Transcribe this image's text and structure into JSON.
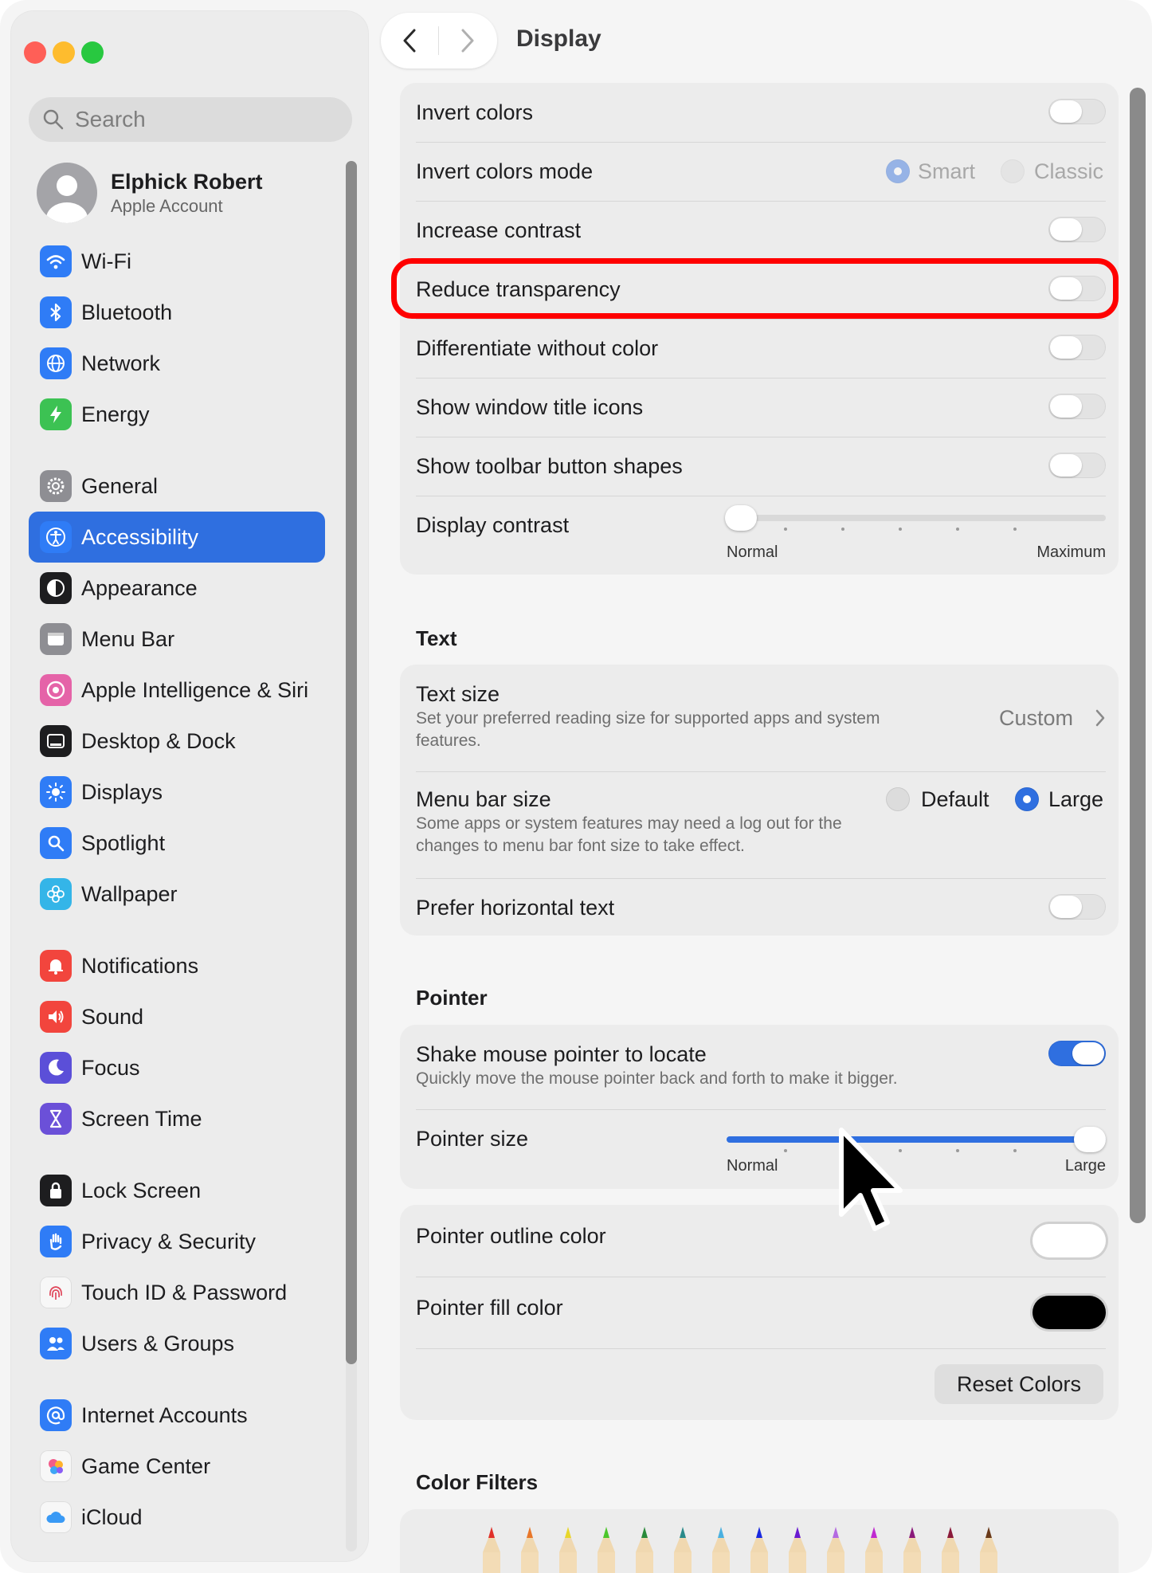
{
  "window": {
    "traffic_lights": [
      "#ff5f57",
      "#febc2e",
      "#28c840"
    ]
  },
  "sidebar": {
    "search_placeholder": "Search",
    "account": {
      "name": "Elphick Robert",
      "subtitle": "Apple Account"
    },
    "items": [
      {
        "label": "Wi-Fi",
        "icon": "wifi-icon",
        "color": "#2f7cf6"
      },
      {
        "label": "Bluetooth",
        "icon": "bluetooth-icon",
        "color": "#2f7cf6"
      },
      {
        "label": "Network",
        "icon": "globe-icon",
        "color": "#2f7cf6"
      },
      {
        "label": "Energy",
        "icon": "bolt-icon",
        "color": "#3cc253"
      },
      {
        "label": "General",
        "icon": "gear-icon",
        "color": "#8e8e93"
      },
      {
        "label": "Accessibility",
        "icon": "accessibility-icon",
        "color": "#2f7cf6",
        "selected": true
      },
      {
        "label": "Appearance",
        "icon": "appearance-icon",
        "color": "#1d1d1f"
      },
      {
        "label": "Menu Bar",
        "icon": "menubar-icon",
        "color": "#8e8e93"
      },
      {
        "label": "Apple Intelligence & Siri",
        "icon": "siri-icon",
        "color": "#e563a8"
      },
      {
        "label": "Desktop & Dock",
        "icon": "dock-icon",
        "color": "#1d1d1f"
      },
      {
        "label": "Displays",
        "icon": "sun-icon",
        "color": "#2f7cf6"
      },
      {
        "label": "Spotlight",
        "icon": "magnifier-icon",
        "color": "#2f7cf6"
      },
      {
        "label": "Wallpaper",
        "icon": "flower-icon",
        "color": "#34b5e8"
      },
      {
        "label": "Notifications",
        "icon": "bell-icon",
        "color": "#f2453d"
      },
      {
        "label": "Sound",
        "icon": "speaker-icon",
        "color": "#f2453d"
      },
      {
        "label": "Focus",
        "icon": "moon-icon",
        "color": "#5b4fd8"
      },
      {
        "label": "Screen Time",
        "icon": "hourglass-icon",
        "color": "#6b50d8"
      },
      {
        "label": "Lock Screen",
        "icon": "lock-icon",
        "color": "#1d1d1f"
      },
      {
        "label": "Privacy & Security",
        "icon": "hand-icon",
        "color": "#2f7cf6"
      },
      {
        "label": "Touch ID & Password",
        "icon": "fingerprint-icon",
        "color": "#f7f7f7"
      },
      {
        "label": "Users & Groups",
        "icon": "users-icon",
        "color": "#2f7cf6"
      },
      {
        "label": "Internet Accounts",
        "icon": "at-icon",
        "color": "#2f7cf6"
      },
      {
        "label": "Game Center",
        "icon": "gamecenter-icon",
        "color": "#f7f7f7"
      },
      {
        "label": "iCloud",
        "icon": "cloud-icon",
        "color": "#f7f7f7"
      }
    ]
  },
  "header": {
    "title": "Display"
  },
  "display": {
    "invert_colors": {
      "label": "Invert colors",
      "on": false
    },
    "invert_mode": {
      "label": "Invert colors mode",
      "options": [
        "Smart",
        "Classic"
      ],
      "selected": "Smart"
    },
    "increase_contrast": {
      "label": "Increase contrast",
      "on": false
    },
    "reduce_transparency": {
      "label": "Reduce transparency",
      "on": false
    },
    "differentiate": {
      "label": "Differentiate without color",
      "on": false
    },
    "title_icons": {
      "label": "Show window title icons",
      "on": false
    },
    "toolbar_shapes": {
      "label": "Show toolbar button shapes",
      "on": false
    },
    "display_contrast": {
      "label": "Display contrast",
      "min_label": "Normal",
      "max_label": "Maximum",
      "level": 0
    }
  },
  "text_section": {
    "heading": "Text",
    "text_size": {
      "label": "Text size",
      "description": "Set your preferred reading size for supported apps and system features.",
      "value": "Custom"
    },
    "menu_bar_size": {
      "label": "Menu bar size",
      "description": "Some apps or system features may need a log out for the changes to menu bar font size to take effect.",
      "options": [
        "Default",
        "Large"
      ],
      "selected": "Large"
    },
    "horizontal_text": {
      "label": "Prefer horizontal text",
      "on": false
    }
  },
  "pointer_section": {
    "heading": "Pointer",
    "shake": {
      "label": "Shake mouse pointer to locate",
      "description": "Quickly move the mouse pointer back and forth to make it bigger.",
      "on": true
    },
    "pointer_size": {
      "label": "Pointer size",
      "min_label": "Normal",
      "max_label": "Large",
      "level": 1.0
    },
    "outline_color": {
      "label": "Pointer outline color",
      "value": "#ffffff"
    },
    "fill_color": {
      "label": "Pointer fill color",
      "value": "#000000"
    },
    "reset_label": "Reset Colors"
  },
  "color_filters": {
    "heading": "Color Filters",
    "pencil_colors": [
      "#e0302a",
      "#e8772a",
      "#e8d62a",
      "#4cc62a",
      "#2a8a3a",
      "#2a8a8a",
      "#4ab0e0",
      "#1a2ae0",
      "#6a1ad0",
      "#b46ae0",
      "#c02ad0",
      "#8a1a7a",
      "#8a1a3a",
      "#6a3a1a"
    ]
  },
  "highlight_color": "#ff0000"
}
